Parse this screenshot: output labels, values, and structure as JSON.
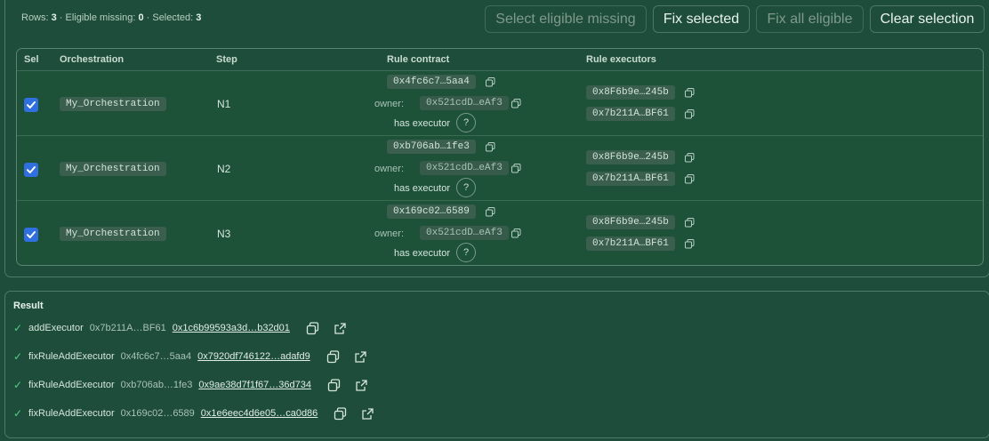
{
  "summary": {
    "rows_label": "Rows:",
    "rows": "3",
    "eligible_label": " · Eligible missing:",
    "eligible": "0",
    "selected_label": " · Selected:",
    "selected": "3"
  },
  "toolbar": {
    "select_eligible": "Select eligible missing",
    "fix_selected": "Fix selected",
    "fix_all": "Fix all eligible",
    "clear": "Clear selection"
  },
  "table": {
    "headers": {
      "sel": "Sel",
      "orchestration": "Orchestration",
      "step": "Step",
      "rule_contract": "Rule contract",
      "rule_executors": "Rule executors"
    },
    "owner_label": "owner:",
    "has_executor_label": "has executor",
    "q_label": "?",
    "rows": [
      {
        "selected": true,
        "orchestration": "My_Orchestration",
        "step": "N1",
        "contract": "0x4fc6c7…5aa4",
        "owner": "0x521cdD…eAf3",
        "executors": [
          "0x8F6b9e…245b",
          "0x7b211A…BF61"
        ]
      },
      {
        "selected": true,
        "orchestration": "My_Orchestration",
        "step": "N2",
        "contract": "0xb706ab…1fe3",
        "owner": "0x521cdD…eAf3",
        "executors": [
          "0x8F6b9e…245b",
          "0x7b211A…BF61"
        ]
      },
      {
        "selected": true,
        "orchestration": "My_Orchestration",
        "step": "N3",
        "contract": "0x169c02…6589",
        "owner": "0x521cdD…eAf3",
        "executors": [
          "0x8F6b9e…245b",
          "0x7b211A…BF61"
        ]
      }
    ]
  },
  "result": {
    "title": "Result",
    "check_glyph": "✓",
    "items": [
      {
        "action": "addExecutor",
        "address": "0x7b211A…BF61",
        "tx": "0x1c6b99593a3d…b32d01"
      },
      {
        "action": "fixRuleAddExecutor",
        "address": "0x4fc6c7…5aa4",
        "tx": "0x7920df746122…adafd9"
      },
      {
        "action": "fixRuleAddExecutor",
        "address": "0xb706ab…1fe3",
        "tx": "0x9ae38d7f1f67…36d734"
      },
      {
        "action": "fixRuleAddExecutor",
        "address": "0x169c02…6589",
        "tx": "0x1e6eec4d6e05…ca0d86"
      }
    ]
  },
  "colors": {
    "background": "#1f4d3c",
    "table_bg": "#1d5238",
    "checkbox": "#2f6fe0",
    "success": "#4fd17f"
  },
  "icons": [
    "checkbox-check-icon",
    "copy-icon",
    "external-link-icon",
    "check-icon",
    "question-icon"
  ]
}
